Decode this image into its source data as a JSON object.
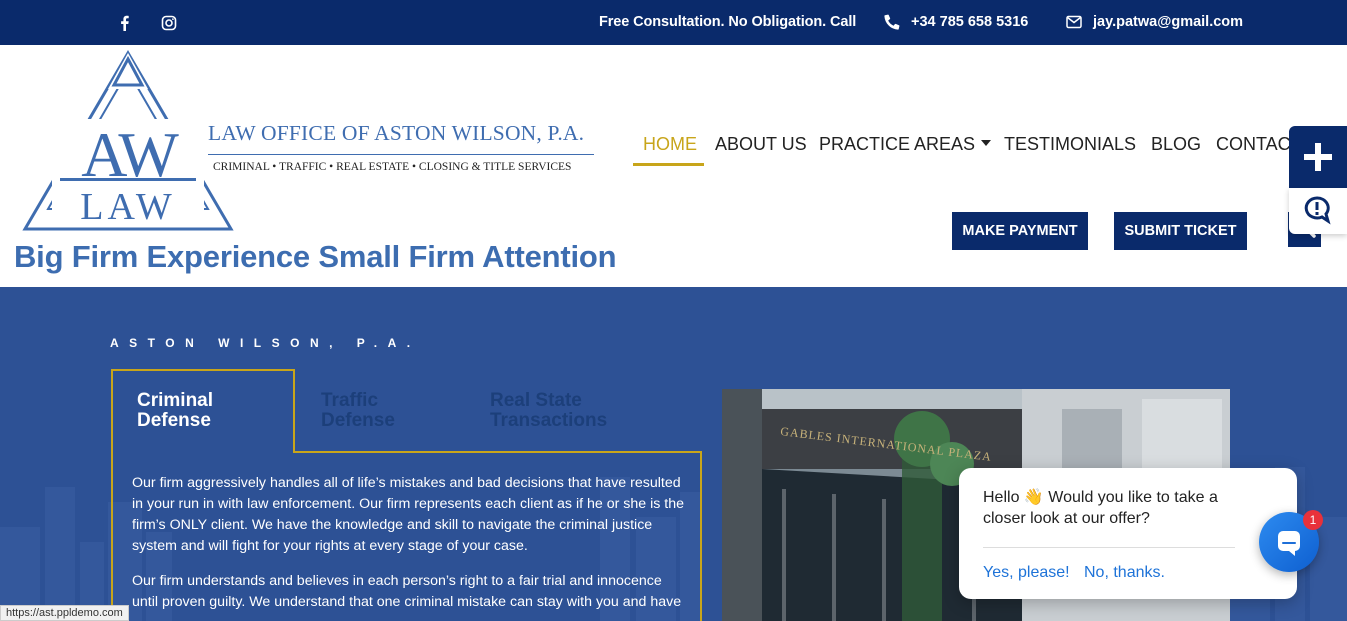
{
  "topbar": {
    "consultation_text": "Free Consultation. No Obligation. Call",
    "phone": "+34 785 658 5316",
    "email": "jay.patwa@gmail.com",
    "social_icons": [
      "facebook-icon",
      "instagram-icon"
    ]
  },
  "logo": {
    "firm_name": "LAW OFFICE OF ASTON WILSON, P.A.",
    "services": "CRIMINAL • TRAFFIC • REAL ESTATE • CLOSING & TITLE SERVICES",
    "mark_top": "AW",
    "mark_bottom": "LAW"
  },
  "tagline": "Big Firm Experience Small Firm Attention",
  "nav": {
    "items": [
      "HOME",
      "ABOUT US",
      "PRACTICE AREAS",
      "TESTIMONIALS",
      "BLOG",
      "CONTACT"
    ],
    "active": "HOME"
  },
  "buttons": {
    "make_payment": "MAKE PAYMENT",
    "submit_ticket": "SUBMIT TICKET"
  },
  "hero": {
    "eyebrow": "ASTON WILSON, P.A.",
    "tabs": [
      {
        "line1": "Criminal",
        "line2": "Defense"
      },
      {
        "line1": "Traffic",
        "line2": "Defense"
      },
      {
        "line1": "Real State",
        "line2": "Transactions"
      }
    ],
    "paragraphs": [
      "Our firm aggressively handles all of life’s mistakes and bad decisions that have resulted in your run in with law enforcement. Our firm represents each client as if he or she is the firm’s ONLY client.  We have the knowledge and skill to navigate the criminal justice system and will fight for your rights at every stage of your case.",
      "Our firm understands and believes in each person’s right to a fair trial and innocence until proven guilty.  We understand that one criminal mistake can stay with you and have"
    ],
    "photo_sign": "GABLES INTERNATIONAL PLAZA"
  },
  "chat": {
    "message": "Hello 👋 Would you like to take a closer look at our offer?",
    "yes": "Yes, please!",
    "no": "No, thanks.",
    "badge": "1"
  },
  "status_url": "https://ast.ppldemo.com",
  "colors": {
    "navy": "#0a2a6b",
    "brand_blue": "#3d6db0",
    "gold": "#c8a51a",
    "hero_bg": "#2d5195"
  }
}
